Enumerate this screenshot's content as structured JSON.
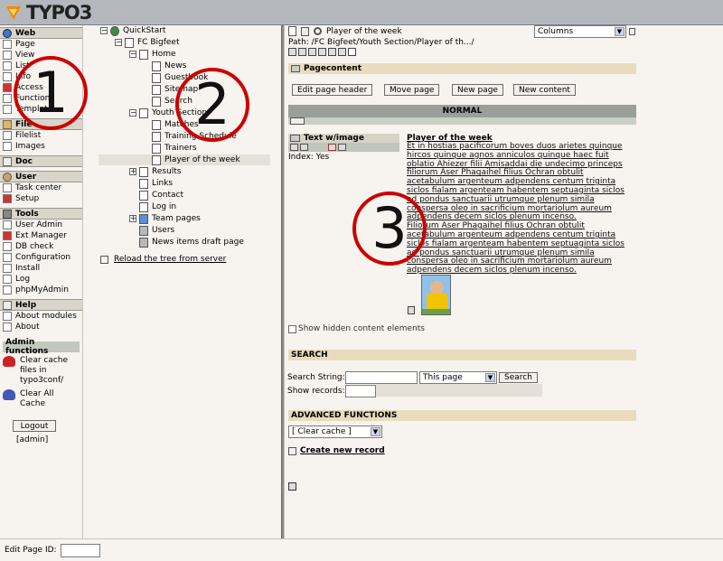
{
  "logo": {
    "text": "TYPO3"
  },
  "modules": [
    {
      "group": "Web",
      "items": [
        "Page",
        "View",
        "List",
        "Info",
        "Access",
        "Functions",
        "Template"
      ]
    },
    {
      "group": "File",
      "items": [
        "Filelist",
        "Images"
      ]
    },
    {
      "group": "Doc",
      "items": []
    },
    {
      "group": "User",
      "items": [
        "Task center",
        "Setup"
      ]
    },
    {
      "group": "Tools",
      "items": [
        "User Admin",
        "Ext Manager",
        "DB check",
        "Configuration",
        "Install",
        "Log",
        "phpMyAdmin"
      ]
    },
    {
      "group": "Help",
      "items": [
        "About modules",
        "About"
      ]
    }
  ],
  "admin": {
    "title": "Admin functions",
    "clear_conf": "Clear cache files in typo3conf/",
    "clear_all": "Clear All Cache",
    "logout": "Logout",
    "user": "[admin]"
  },
  "tree": {
    "nodes": [
      "QuickStart",
      "FC Bigfeet",
      "Home",
      "News",
      "Guestbook",
      "Sitemap",
      "Search",
      "Youth Section",
      "Matches",
      "Training Schedule",
      "Trainers",
      "Player of the week",
      "Results",
      "Links",
      "Contact",
      "Log in",
      "Team pages",
      "Users",
      "News items draft page"
    ],
    "reload": "Reload the tree from server"
  },
  "content": {
    "page_title": "Player of the week",
    "path": "Path: /FC Bigfeet/Youth Section/Player of th.../",
    "view_select": "Columns",
    "section_pagecontent": "Pagecontent",
    "buttons": [
      "Edit page header",
      "Move page",
      "New page",
      "New content"
    ],
    "column": "NORMAL",
    "ce_type": "Text w/image",
    "ce_index": "Index: Yes",
    "ce_title": "Player of the week",
    "ce_lines": [
      "Et in hostias pacificorum boves duos arietes quinque",
      "hircos quinque agnos anniculos quinque haec fuit",
      "oblatio Ahiezer filii Amisaddai die undecimo princeps",
      "filiorum Aser Phagaihel filius Ochran obtulit",
      "acetabulum argenteum adpendens centum triginta",
      "siclos fialam argenteam habentem septuaginta siclos",
      "ad pondus sanctuarii utrumque plenum simila",
      "conspersa oleo in sacrificium mortariolum aureum",
      "adpendens decem siclos plenum incenso.",
      "Filiorum Aser Phagaihel filius Ochran obtulit",
      "acetabulum argenteum adpendens centum triginta",
      "siclos fialam argenteam habentem septuaginta siclos",
      "ad pondus sanctuarii utrumque plenum simila",
      "conspersa oleo in sacrificium mortariolum aureum",
      "adpendens decem siclos plenum incenso."
    ],
    "show_hidden": "Show hidden content elements",
    "search_section": "SEARCH",
    "search_string_label": "Search String:",
    "search_scope": "This page",
    "search_button": "Search",
    "show_records_label": "Show records:",
    "advanced_section": "ADVANCED FUNCTIONS",
    "clear_cache_select": "[ Clear cache ]",
    "create_record": "Create new record"
  },
  "steps": [
    "1",
    "2",
    "3"
  ],
  "bottom": {
    "edit_page_label": "Edit Page ID:"
  }
}
